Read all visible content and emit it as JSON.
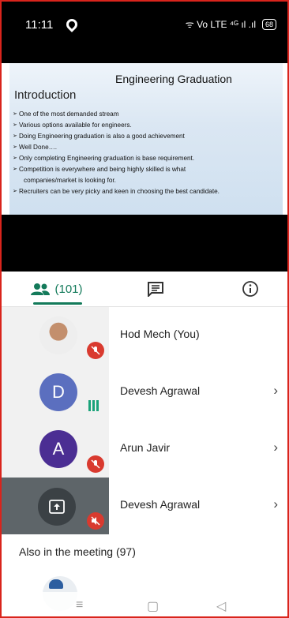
{
  "status_bar": {
    "time": "11:11",
    "signal_text": "ᯤ Vo LTE ⁴ᴳ ıl .ıl",
    "battery": "68"
  },
  "slide": {
    "title": "Engineering Graduation",
    "subtitle": "Introduction",
    "bullets": [
      "One of the most demanded stream",
      "Various options available for engineers.",
      "Doing Engineering graduation is also a good achievement",
      "Well Done….",
      "Only completing Engineering  graduation is base requirement.",
      "Competition is everywhere and being highly skilled is what",
      "companies/market is looking for.",
      "Recruiters can be very picky and keen in choosing the best candidate."
    ]
  },
  "tabs": {
    "people_count": "(101)"
  },
  "participants": [
    {
      "name": "Hod Mech (You)",
      "initial": "",
      "color": "#ffffff"
    },
    {
      "name": "Devesh Agrawal",
      "initial": "D",
      "color": "#5b6fbf"
    },
    {
      "name": "Arun Javir",
      "initial": "A",
      "color": "#4b2e93"
    },
    {
      "name": "Devesh Agrawal",
      "initial": "",
      "color": "#3b4145"
    }
  ],
  "also_in_meeting": "Also in the meeting (97)",
  "colors": {
    "accent": "#137a5a",
    "mute_red": "#d93a2f",
    "frame_red": "#d9241c"
  }
}
